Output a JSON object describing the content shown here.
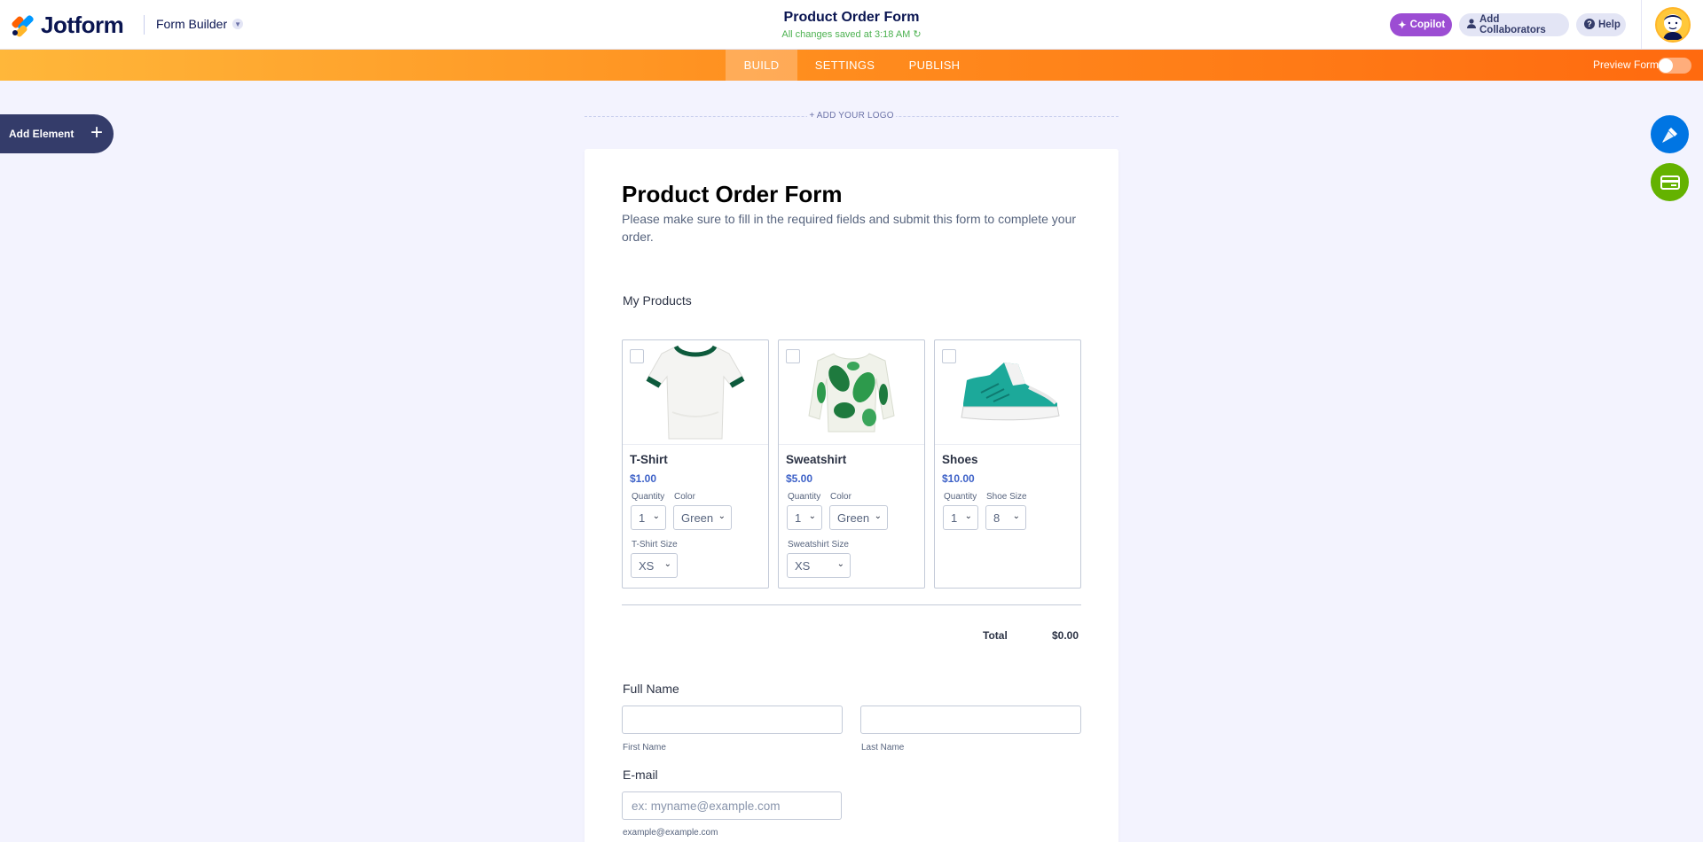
{
  "header": {
    "logo_text": "Jotform",
    "builder_label": "Form Builder",
    "form_title": "Product Order Form",
    "saved_status": "All changes saved at 3:18 AM",
    "copilot_label": "Copilot",
    "collaborators_label": "Add Collaborators",
    "help_label": "Help"
  },
  "nav": {
    "tabs": [
      {
        "label": "BUILD",
        "active": true
      },
      {
        "label": "SETTINGS",
        "active": false
      },
      {
        "label": "PUBLISH",
        "active": false
      }
    ],
    "preview_label": "Preview Form",
    "preview_on": false
  },
  "sidebar": {
    "add_element_label": "Add Element"
  },
  "form": {
    "add_logo_label": "+ ADD YOUR LOGO",
    "heading": "Product Order Form",
    "description": "Please make sure to fill in the required fields and submit this form to complete your order.",
    "products_label": "My Products",
    "products": [
      {
        "name": "T-Shirt",
        "price": "$1.00",
        "options": [
          {
            "label": "Quantity",
            "value": "1"
          },
          {
            "label": "Color",
            "value": "Green"
          },
          {
            "label": "T-Shirt Size",
            "value": "XS"
          }
        ]
      },
      {
        "name": "Sweatshirt",
        "price": "$5.00",
        "options": [
          {
            "label": "Quantity",
            "value": "1"
          },
          {
            "label": "Color",
            "value": "Green"
          },
          {
            "label": "Sweatshirt Size",
            "value": "XS"
          }
        ]
      },
      {
        "name": "Shoes",
        "price": "$10.00",
        "options": [
          {
            "label": "Quantity",
            "value": "1"
          },
          {
            "label": "Shoe Size",
            "value": "8"
          }
        ]
      }
    ],
    "total_label": "Total",
    "total_value": "$0.00",
    "full_name_label": "Full Name",
    "first_name_sublabel": "First Name",
    "last_name_sublabel": "Last Name",
    "email_label": "E-mail",
    "email_placeholder": "ex: myname@example.com",
    "email_sublabel": "example@example.com"
  },
  "colors": {
    "brand_navy": "#0a1551",
    "copilot_purple": "#9c4dd3",
    "nav_orange": "#ff6a0f",
    "price_blue": "#3e62c8",
    "saved_green": "#4bb14f"
  }
}
